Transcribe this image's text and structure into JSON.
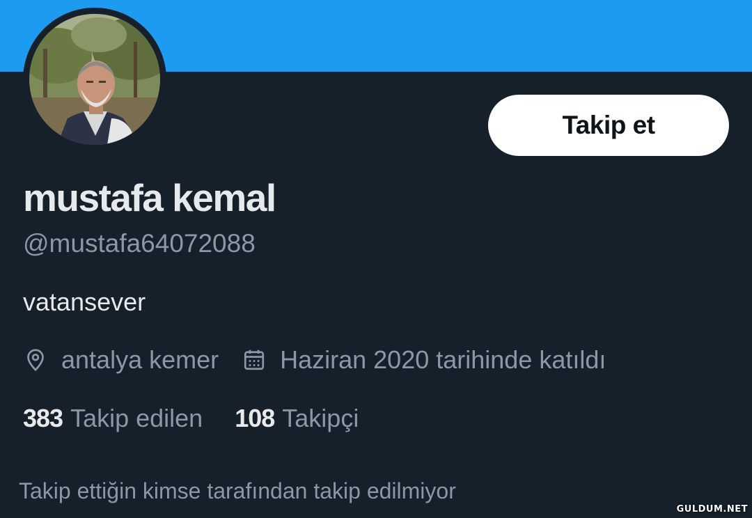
{
  "banner": {
    "color": "#1d9bf0"
  },
  "profile": {
    "display_name": "mustafa kemal",
    "handle": "@mustafa64072088",
    "bio": "vatansever",
    "location": "antalya kemer",
    "location_icon": "location-pin-icon",
    "joined": "Haziran 2020 tarihinde katıldı",
    "joined_icon": "calendar-icon"
  },
  "actions": {
    "follow_label": "Takip et"
  },
  "stats": {
    "following_count": "383",
    "following_label": "Takip edilen",
    "followers_count": "108",
    "followers_label": "Takipçi"
  },
  "mutual_note": "Takip ettiğin kimse tarafından takip edilmiyor",
  "watermark": "GULDUM.NET",
  "colors": {
    "background": "#15202b",
    "accent": "#1d9bf0",
    "primary_text": "#e7e9ea",
    "secondary_text": "#8b98a5"
  }
}
